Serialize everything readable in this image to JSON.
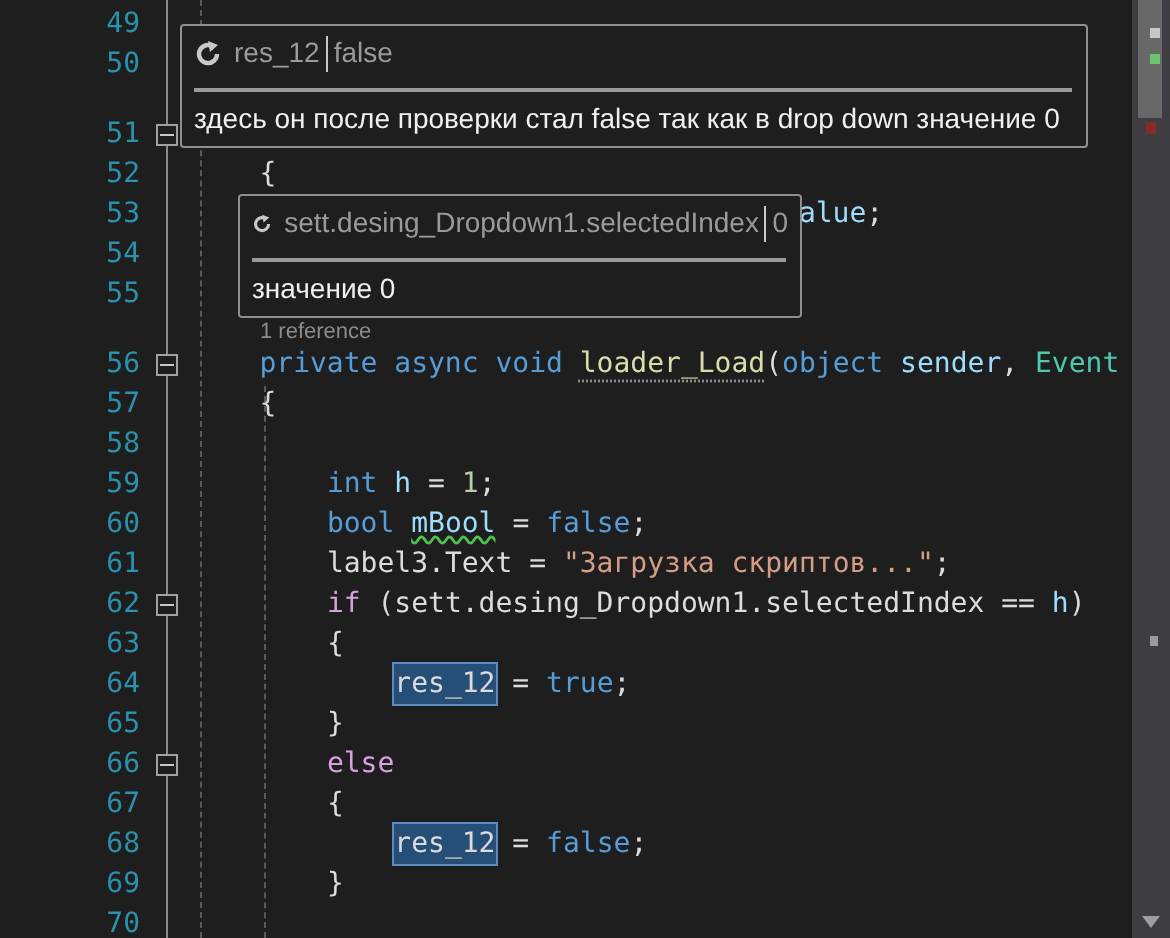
{
  "editor": {
    "lines": [
      {
        "kind": "code",
        "number": "49"
      },
      {
        "kind": "code",
        "number": "50"
      },
      {
        "kind": "codelens"
      },
      {
        "kind": "code",
        "number": "51",
        "fold_expanded": true
      },
      {
        "kind": "code",
        "number": "52",
        "tokens": [
          {
            "kind": "plain",
            "text": "    {"
          }
        ]
      },
      {
        "kind": "code",
        "number": "53",
        "tokens": [
          {
            "kind": "variable",
            "text": "                                    alue"
          },
          {
            "kind": "plain",
            "text": ";"
          }
        ]
      },
      {
        "kind": "code",
        "number": "54"
      },
      {
        "kind": "code",
        "number": "55"
      },
      {
        "kind": "codelens",
        "text": "1 reference"
      },
      {
        "kind": "code",
        "number": "56",
        "fold_expanded": true,
        "tokens": [
          {
            "kind": "keyword",
            "text": "    private async void "
          },
          {
            "kind": "method",
            "text": "loader_Load",
            "hint_dots": true
          },
          {
            "kind": "plain",
            "text": "("
          },
          {
            "kind": "keyword",
            "text": "object "
          },
          {
            "kind": "variable",
            "text": "sender"
          },
          {
            "kind": "plain",
            "text": ", "
          },
          {
            "kind": "type",
            "text": "Event"
          }
        ]
      },
      {
        "kind": "code",
        "number": "57",
        "tokens": [
          {
            "kind": "plain",
            "text": "    {"
          }
        ]
      },
      {
        "kind": "code",
        "number": "58"
      },
      {
        "kind": "code",
        "number": "59",
        "tokens": [
          {
            "kind": "keyword",
            "text": "        int "
          },
          {
            "kind": "variable",
            "text": "h"
          },
          {
            "kind": "plain",
            "text": " = "
          },
          {
            "kind": "number",
            "text": "1"
          },
          {
            "kind": "plain",
            "text": ";"
          }
        ]
      },
      {
        "kind": "code",
        "number": "60",
        "tokens": [
          {
            "kind": "keyword",
            "text": "        bool "
          },
          {
            "kind": "variable",
            "text": "mBool",
            "squiggle": true
          },
          {
            "kind": "plain",
            "text": " = "
          },
          {
            "kind": "keyword",
            "text": "false"
          },
          {
            "kind": "plain",
            "text": ";"
          }
        ]
      },
      {
        "kind": "code",
        "number": "61",
        "tokens": [
          {
            "kind": "plain",
            "text": "        label3.Text = "
          },
          {
            "kind": "string",
            "text": "\"Загрузка скриптов...\""
          },
          {
            "kind": "plain",
            "text": ";"
          }
        ]
      },
      {
        "kind": "code",
        "number": "62",
        "fold_expanded": true,
        "tokens": [
          {
            "kind": "control",
            "text": "        if"
          },
          {
            "kind": "plain",
            "text": " (sett.desing_Dropdown1.selectedIndex == "
          },
          {
            "kind": "variable",
            "text": "h"
          },
          {
            "kind": "plain",
            "text": ")"
          }
        ]
      },
      {
        "kind": "code",
        "number": "63",
        "tokens": [
          {
            "kind": "plain",
            "text": "        {"
          }
        ]
      },
      {
        "kind": "code",
        "number": "64",
        "tokens": [
          {
            "kind": "plain",
            "text": "            res_12",
            "highlighted": true
          },
          {
            "kind": "plain",
            "text": " = "
          },
          {
            "kind": "keyword",
            "text": "true"
          },
          {
            "kind": "plain",
            "text": ";"
          }
        ]
      },
      {
        "kind": "code",
        "number": "65",
        "tokens": [
          {
            "kind": "plain",
            "text": "        }"
          }
        ]
      },
      {
        "kind": "code",
        "number": "66",
        "fold_expanded": true,
        "tokens": [
          {
            "kind": "control",
            "text": "        else"
          }
        ]
      },
      {
        "kind": "code",
        "number": "67",
        "tokens": [
          {
            "kind": "plain",
            "text": "        {"
          }
        ]
      },
      {
        "kind": "code",
        "number": "68",
        "tokens": [
          {
            "kind": "plain",
            "text": "            res_12",
            "highlighted": true
          },
          {
            "kind": "plain",
            "text": " = "
          },
          {
            "kind": "keyword",
            "text": "false"
          },
          {
            "kind": "plain",
            "text": ";"
          }
        ]
      },
      {
        "kind": "code",
        "number": "69",
        "tokens": [
          {
            "kind": "plain",
            "text": "        }"
          }
        ]
      },
      {
        "kind": "code",
        "number": "70"
      }
    ]
  },
  "datatips": [
    {
      "name": "res_12",
      "value": "false",
      "comment": "здесь он после проверки стал false так как в drop down значение 0"
    },
    {
      "name": "sett.desing_Dropdown1.selectedIndex",
      "value": "0",
      "comment": "значение 0"
    }
  ]
}
